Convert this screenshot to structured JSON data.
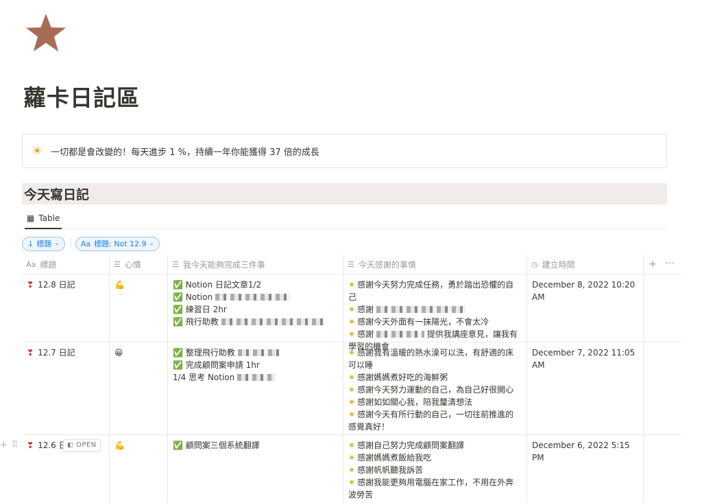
{
  "page": {
    "icon": "star-icon",
    "title": "蘿卡日記區",
    "callout": {
      "icon": "sun-icon",
      "text": "一切都是會改變的！每天進步 1 %，持續一年你能獲得 37 倍的成長"
    },
    "section_heading": "今天寫日記"
  },
  "view": {
    "tab_label": "Table",
    "tab_icon": "table-icon"
  },
  "filters": [
    {
      "label": "標題",
      "icon": "arrow-down-icon"
    },
    {
      "label": "標題: Not 12.9",
      "prefix": "Aa"
    }
  ],
  "columns": [
    {
      "label": "標題",
      "icon": "Aa"
    },
    {
      "label": "心情",
      "icon": "text-lines-icon"
    },
    {
      "label": "我今天能夠完成三件事",
      "icon": "text-lines-icon"
    },
    {
      "label": "今天感謝的事情",
      "icon": "text-lines-icon"
    },
    {
      "label": "建立時間",
      "icon": "clock-icon"
    }
  ],
  "rows": [
    {
      "title": "12.8 日記",
      "mood": "💪",
      "tasks": [
        "✅ Notion 日記文章1/2",
        "✅ Notion",
        "✅ 練習日  2hr",
        "✅ 飛行助教"
      ],
      "gratitude": [
        "感謝今天努力完成任務，勇於踏出恐懼的自己",
        "感謝",
        "感謝今天外面有一抹陽光，不會太冷",
        "感謝",
        "提供我講座意見，讓我有學習的機會"
      ],
      "created": "December 8, 2022 10:20 AM"
    },
    {
      "title": "12.7 日記",
      "mood": "😀",
      "tasks": [
        "✅ 整理飛行助教",
        "✅ 完成顧問案申請 1hr",
        "1/4 思考 Notion"
      ],
      "gratitude": [
        "感謝我有溫暖的熱水澡可以洗，有舒適的床可以睡",
        "感謝媽媽煮好吃的海鮮粥",
        "感謝今天努力運動的自己，為自己好很開心",
        "感謝如如關心我，陪我釐清想法",
        "感謝今天有所行動的自己，一切往前推進的感覺真好！"
      ],
      "created": "December 7, 2022 11:05 AM"
    },
    {
      "title": "12.6 日",
      "mood": "💪",
      "tasks": [
        "✅ 顧問案三個系統翻譯"
      ],
      "gratitude": [
        "感謝自己努力完成顧問案翻譯",
        "感謝媽媽煮飯給我吃",
        "感謝帆帆聽我訴苦",
        "感謝我能更夠用電腦在家工作，不用在外奔波勞苦"
      ],
      "created": "December 6, 2022 5:15 PM",
      "hover_button": "OPEN"
    }
  ]
}
